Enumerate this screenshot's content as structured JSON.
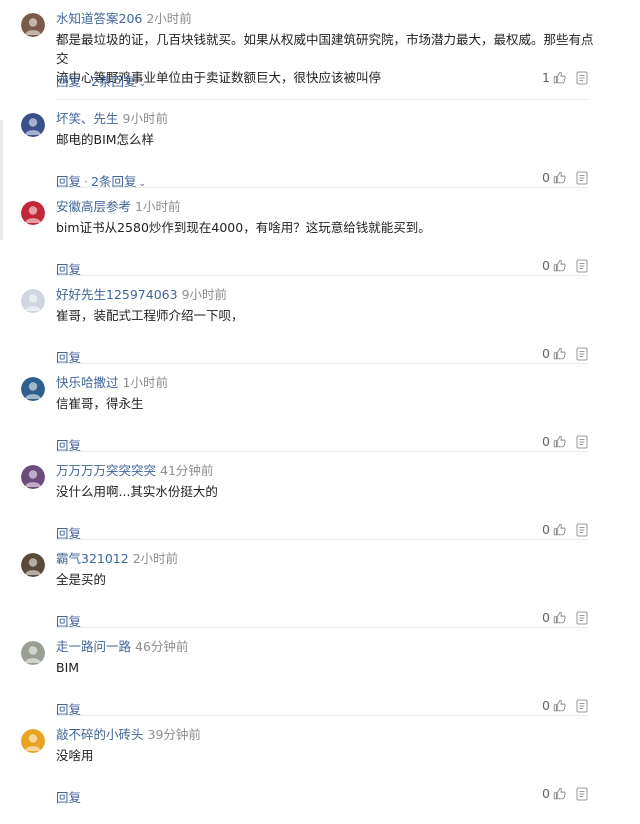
{
  "comments": [
    {
      "user": "水知道答案206",
      "time": "2小时前",
      "text": "都是最垃圾的证，几百块钱就买。如果从权威中国建筑研究院，市场潜力最大，最权威。那些有点交\n流中心等野鸡事业单位由于卖证数额巨大，很快应该被叫停",
      "reply": "回复",
      "replies": "2条回复",
      "likes": "1",
      "avatar_color": "#7a5a4a"
    },
    {
      "user": "坏笑、先生",
      "time": "9小时前",
      "text": "邮电的BIM怎么样",
      "reply": "回复",
      "replies": "2条回复",
      "likes": "0",
      "avatar_color": "#3b4f8c"
    },
    {
      "user": "安徽高层参考",
      "time": "1小时前",
      "text": "bim证书从2580炒作到现在4000，有啥用？这玩意给钱就能买到。",
      "reply": "回复",
      "replies": "",
      "likes": "0",
      "avatar_color": "#c0283a"
    },
    {
      "user": "好好先生125974063",
      "time": "9小时前",
      "text": "崔哥，装配式工程师介绍一下呗，",
      "reply": "回复",
      "replies": "",
      "likes": "0",
      "avatar_color": "#cfd6e0"
    },
    {
      "user": "快乐哈撒过",
      "time": "1小时前",
      "text": "信崔哥，得永生",
      "reply": "回复",
      "replies": "",
      "likes": "0",
      "avatar_color": "#2f5f8f"
    },
    {
      "user": "万万万万突突突突",
      "time": "41分钟前",
      "text": "没什么用啊...其实水份挺大的",
      "reply": "回复",
      "replies": "",
      "likes": "0",
      "avatar_color": "#6c4b7d"
    },
    {
      "user": "霸气321012",
      "time": "2小时前",
      "text": "全是买的",
      "reply": "回复",
      "replies": "",
      "likes": "0",
      "avatar_color": "#5a4a3a"
    },
    {
      "user": "走一路问一路",
      "time": "46分钟前",
      "text": "BIM",
      "reply": "回复",
      "replies": "",
      "likes": "0",
      "avatar_color": "#9a9f93"
    },
    {
      "user": "敲不碎的小砖头",
      "time": "39分钟前",
      "text": "没啥用",
      "reply": "回复",
      "replies": "",
      "likes": "0",
      "avatar_color": "#e8a321"
    }
  ],
  "icons": {
    "like": "thumbs-up-icon",
    "more": "more-options-icon",
    "expand": "chevron-down-icon"
  },
  "colors": {
    "username": "#406599",
    "time": "#8e8e8e",
    "text": "#222222",
    "divider": "#ececec"
  }
}
